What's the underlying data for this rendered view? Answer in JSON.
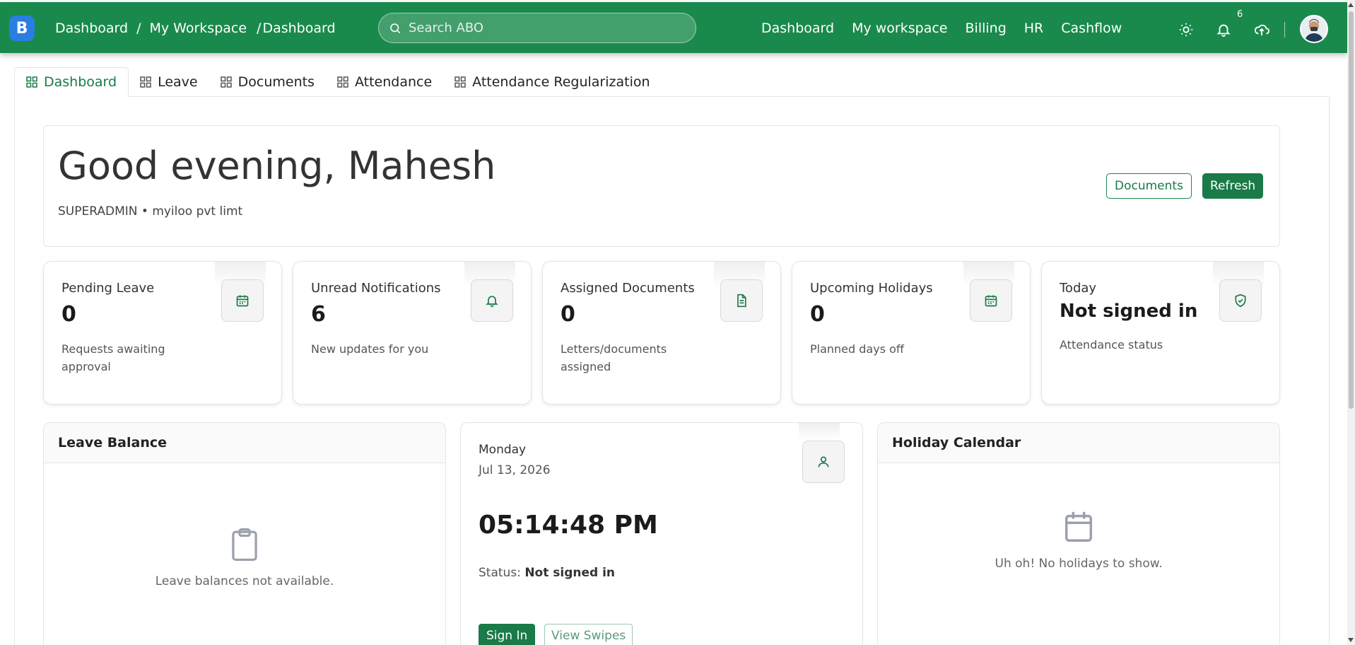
{
  "colors": {
    "primary": "#1a8a4c",
    "primary_dark": "#1a7a48",
    "logo": "#2a7de1"
  },
  "app": {
    "logo_letter": "B"
  },
  "breadcrumb": {
    "items": [
      "Dashboard",
      "My Workspace",
      "Dashboard"
    ],
    "sep": "/"
  },
  "search": {
    "placeholder": "Search ABO"
  },
  "topnav": [
    "Dashboard",
    "My workspace",
    "Billing",
    "HR",
    "Cashflow"
  ],
  "notifications": {
    "badge": "6"
  },
  "tabs": [
    "Dashboard",
    "Leave",
    "Documents",
    "Attendance",
    "Attendance Regularization"
  ],
  "greeting": {
    "title": "Good evening, Mahesh",
    "role": "SUPERADMIN",
    "dot": "•",
    "company": "myiloo pvt limt",
    "documents_button": "Documents",
    "refresh_button": "Refresh"
  },
  "stats": [
    {
      "label": "Pending Leave",
      "value": "0",
      "desc": "Requests awaiting approval",
      "icon": "calendar-icon"
    },
    {
      "label": "Unread Notifications",
      "value": "6",
      "desc": "New updates for you",
      "icon": "bell-icon"
    },
    {
      "label": "Assigned Documents",
      "value": "0",
      "desc": "Letters/documents assigned",
      "icon": "document-icon"
    },
    {
      "label": "Upcoming Holidays",
      "value": "0",
      "desc": "Planned days off",
      "icon": "calendar-icon"
    },
    {
      "label": "Today",
      "value": "Not signed in",
      "desc": "Attendance status",
      "icon": "shield-check-icon"
    }
  ],
  "leave_balance": {
    "title": "Leave Balance",
    "empty": "Leave balances not available."
  },
  "clock": {
    "day": "Monday",
    "date": "Jul 13, 2026",
    "time": "05:14:48 PM",
    "status_label": "Status:",
    "status_value": "Not signed in",
    "sign_in": "Sign In",
    "view_swipes": "View Swipes"
  },
  "holiday_calendar": {
    "title": "Holiday Calendar",
    "empty": "Uh oh! No holidays to show."
  }
}
